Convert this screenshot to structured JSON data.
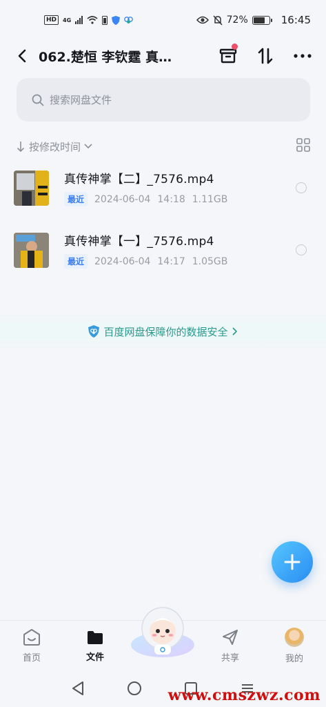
{
  "status_bar": {
    "hd_label": "HD",
    "network_label": "4G",
    "battery_percent": "72%",
    "battery_level": 0.72,
    "time": "16:45"
  },
  "header": {
    "title": "062.楚恒 李钦霆 真…",
    "icons": [
      "back-arrow",
      "archive-box",
      "sort-arrows",
      "more-dots"
    ]
  },
  "search": {
    "placeholder": "搜索网盘文件"
  },
  "sort": {
    "label": "按修改时间"
  },
  "files": [
    {
      "name": "真传神掌【二】_7576.mp4",
      "badge": "最近",
      "date": "2024-06-04",
      "time": "14:18",
      "size": "1.11GB"
    },
    {
      "name": "真传神掌【一】_7576.mp4",
      "badge": "最近",
      "date": "2024-06-04",
      "time": "14:17",
      "size": "1.05GB"
    }
  ],
  "banner": {
    "text": "百度网盘保障你的数据安全"
  },
  "tabs": [
    {
      "label": "首页",
      "icon": "home-face"
    },
    {
      "label": "文件",
      "icon": "folder"
    },
    {
      "label": "共享",
      "icon": "paper-plane"
    },
    {
      "label": "我的",
      "icon": "avatar"
    }
  ],
  "watermark": "www.cmszwz.com",
  "colors": {
    "accent": "#2a8cf2",
    "background": "#f5f6f9",
    "safety_text": "#2a9a8e",
    "badge": "#3d7ef0",
    "notification_dot": "#ee4f6a"
  }
}
